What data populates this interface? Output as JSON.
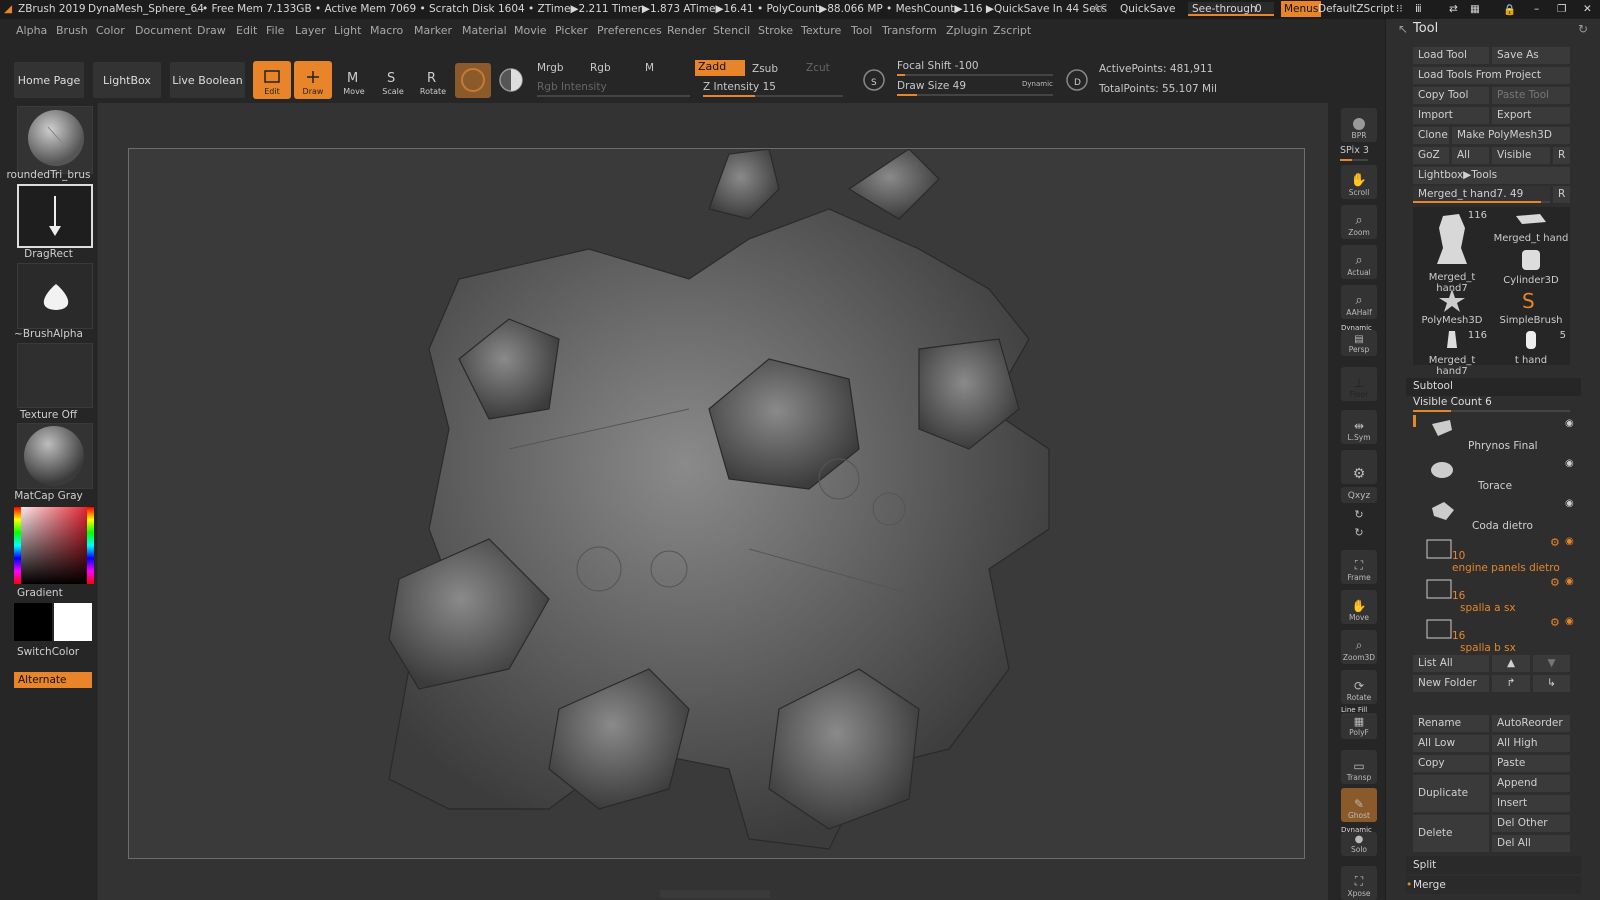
{
  "titlebar": {
    "app": "ZBrush 2019",
    "doc": "DynaMesh_Sphere_64",
    "stats": ".. • Free Mem 7.133GB • Active Mem 7069 • Scratch Disk 1604 • ZTime▶2.211 Timer▶1.873 ATime▶16.41 • PolyCount▶88.066 MP • MeshCount▶116 ▶QuickSave In 44 Secs",
    "ac": "AC",
    "quicksave": "QuickSave",
    "see_through": "See-through",
    "see_through_value": "0",
    "menus": "Menus",
    "script": "DefaultZScript"
  },
  "menubar": [
    "Alpha",
    "Brush",
    "Color",
    "Document",
    "Draw",
    "Edit",
    "File",
    "Layer",
    "Light",
    "Macro",
    "Marker",
    "Material",
    "Movie",
    "Picker",
    "Preferences",
    "Render",
    "Stencil",
    "Stroke",
    "Texture",
    "Tool",
    "Transform",
    "Zplugin",
    "Zscript"
  ],
  "shelf": {
    "home": "Home Page",
    "lightbox": "LightBox",
    "live_boolean": "Live Boolean",
    "edit": "Edit",
    "draw": "Draw",
    "move": "Move",
    "scale": "Scale",
    "rotate": "Rotate",
    "mrgb": "Mrgb",
    "rgb": "Rgb",
    "m": "M",
    "zadd": "Zadd",
    "zsub": "Zsub",
    "zcut": "Zcut",
    "rgb_intensity": "Rgb Intensity",
    "z_intensity": "Z Intensity 15",
    "focal_shift": "Focal Shift -100",
    "draw_size": "Draw Size 49",
    "dynamic": "Dynamic",
    "active_points": "ActivePoints: 481,911",
    "total_points": "TotalPoints: 55.107 Mil",
    "s": "S",
    "d": "D"
  },
  "left": {
    "brush": "roundedTri_brus",
    "stroke": "DragRect",
    "alpha": "~BrushAlpha",
    "texture": "Texture Off",
    "material": "MatCap Gray",
    "gradient": "Gradient",
    "switch_color": "SwitchColor",
    "alternate": "Alternate"
  },
  "rightstrip": {
    "bpr": "BPR",
    "spix": "SPix 3",
    "scroll": "Scroll",
    "zoom": "Zoom",
    "actual": "Actual",
    "aahalf": "AAHalf",
    "dynamic": "Dynamic",
    "persp": "Persp",
    "floor": "Floor",
    "lsym": "L.Sym",
    "xyz": "Qxyz",
    "frame": "Frame",
    "move": "Move",
    "zoom3d": "Zoom3D",
    "rotate": "Rotate",
    "linefill": "Line Fill",
    "polyf": "PolyF",
    "transp": "Transp",
    "ghost": "Ghost",
    "solo": "Solo",
    "dynamic2": "Dynamic",
    "xpose": "Xpose"
  },
  "tool": {
    "title": "Tool",
    "load_tool": "Load Tool",
    "save_as": "Save As",
    "load_from_project": "Load Tools From Project",
    "copy_tool": "Copy Tool",
    "paste_tool": "Paste Tool",
    "import": "Import",
    "export": "Export",
    "clone": "Clone",
    "make_polymesh": "Make PolyMesh3D",
    "goz": "GoZ",
    "all": "All",
    "visible": "Visible",
    "r": "R",
    "lightbox_tools": "Lightbox▶Tools",
    "current_tool": "Merged_t hand7. 49",
    "thumbs": [
      {
        "name": "Merged_t hand7",
        "count": "116"
      },
      {
        "name": "Merged_t hand",
        "count": ""
      },
      {
        "name": "Cylinder3D",
        "count": ""
      },
      {
        "name": "PolyMesh3D",
        "count": ""
      },
      {
        "name": "SimpleBrush",
        "count": ""
      },
      {
        "name": "Merged_t hand7",
        "count": "116"
      },
      {
        "name": "t hand",
        "count": "5"
      }
    ],
    "subtool": "Subtool",
    "visible_count": "Visible Count 6",
    "subtools": [
      {
        "name": "Phrynos Final",
        "count": ""
      },
      {
        "name": "Torace",
        "count": ""
      },
      {
        "name": "Coda dietro",
        "count": ""
      },
      {
        "name": "engine panels dietro",
        "count": "10"
      },
      {
        "name": "spalla a sx",
        "count": "16"
      },
      {
        "name": "spalla b sx",
        "count": "16"
      }
    ],
    "list_all": "List All",
    "new_folder": "New Folder",
    "rename": "Rename",
    "autoreorder": "AutoReorder",
    "all_low": "All Low",
    "all_high": "All High",
    "copy": "Copy",
    "paste": "Paste",
    "duplicate": "Duplicate",
    "append": "Append",
    "insert": "Insert",
    "delete": "Delete",
    "del_other": "Del Other",
    "del_all": "Del All",
    "split": "Split",
    "merge": "Merge"
  },
  "colors": {
    "accent": "#e8852a",
    "panel": "#2e2e2e",
    "canvas": "#3a3a3a"
  }
}
